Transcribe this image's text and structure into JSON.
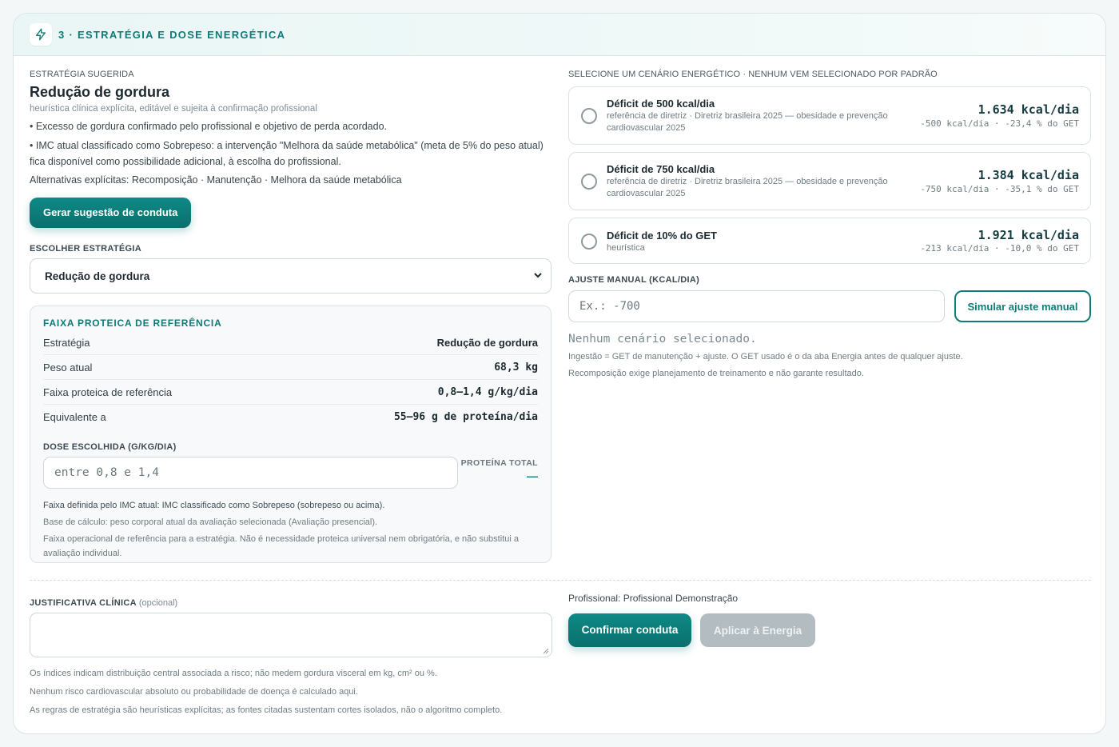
{
  "header": {
    "title": "3 · ESTRATÉGIA E DOSE ENERGÉTICA",
    "icon": "bolt-icon"
  },
  "strategy": {
    "section_label": "ESTRATÉGIA SUGERIDA",
    "title": "Redução de gordura",
    "subtitle": "heurística clínica explícita, editável e sujeita à confirmação profissional",
    "bullets": [
      "• Excesso de gordura confirmado pelo profissional e objetivo de perda acordado.",
      "• IMC atual classificado como Sobrepeso: a intervenção \"Melhora da saúde metabólica\" (meta de 5% do peso atual) fica disponível como possibilidade adicional, à escolha do profissional."
    ],
    "alternatives": "Alternativas explícitas: Recomposição · Manutenção · Melhora da saúde metabólica",
    "suggest_button": "Gerar sugestão de conduta",
    "choose_label": "ESCOLHER ESTRATÉGIA",
    "choose_value": "Redução de gordura"
  },
  "reference": {
    "title": "FAIXA PROTEICA DE REFERÊNCIA",
    "rows": [
      {
        "label": "Estratégia",
        "value": "Redução de gordura"
      },
      {
        "label": "Peso atual",
        "value": "68,3 kg"
      },
      {
        "label": "Faixa proteica de referência",
        "value": "0,8–1,4 g/kg/dia"
      },
      {
        "label": "Equivalente a",
        "value": "55–96 g de proteína/dia"
      }
    ],
    "dose_label": "DOSE ESCOLHIDA (G/KG/DIA)",
    "dose_placeholder": "entre 0,8 e 1,4",
    "total_label": "PROTEÍNA TOTAL",
    "total_value": "—",
    "notes": [
      "Faixa definida pelo IMC atual: IMC classificado como Sobrepeso (sobrepeso ou acima).",
      "Base de cálculo: peso corporal atual da avaliação selecionada (Avaliação presencial).",
      "Faixa operacional de referência para a estratégia. Não é necessidade proteica universal nem obrigatória, e não substitui a avaliação individual."
    ]
  },
  "scenarios": {
    "section_label": "SELECIONE UM CENÁRIO ENERGÉTICO · NENHUM VEM SELECIONADO POR PADRÃO",
    "items": [
      {
        "title": "Déficit de 500 kcal/dia",
        "source": "referência de diretriz · Diretriz brasileira 2025 — obesidade e prevenção cardiovascular 2025",
        "kcal": "1.634 kcal/dia",
        "delta": "-500 kcal/dia · -23,4 % do GET"
      },
      {
        "title": "Déficit de 750 kcal/dia",
        "source": "referência de diretriz · Diretriz brasileira 2025 — obesidade e prevenção cardiovascular 2025",
        "kcal": "1.384 kcal/dia",
        "delta": "-750 kcal/dia · -35,1 % do GET"
      },
      {
        "title": "Déficit de 10% do GET",
        "source": "heurística",
        "kcal": "1.921 kcal/dia",
        "delta": "-213 kcal/dia · -10,0 % do GET"
      }
    ],
    "manual_label": "AJUSTE MANUAL (KCAL/DIA)",
    "manual_placeholder": "Ex.: -700",
    "simulate_button": "Simular ajuste manual",
    "none_selected": "Nenhum cenário selecionado.",
    "info": [
      "Ingestão = GET de manutenção + ajuste. O GET usado é o da aba Energia antes de qualquer ajuste.",
      "Recomposição exige planejamento de treinamento e não garante resultado."
    ]
  },
  "footer": {
    "justification_label": "JUSTIFICATIVA CLÍNICA",
    "justification_optional": "(opcional)",
    "disclaimers": [
      "Os índices indicam distribuição central associada a risco; não medem gordura visceral em kg, cm² ou %.",
      "Nenhum risco cardiovascular absoluto ou probabilidade de doença é calculado aqui.",
      "As regras de estratégia são heurísticas explícitas; as fontes citadas sustentam cortes isolados, não o algoritmo completo."
    ],
    "professional": "Profissional: Profissional Demonstração",
    "confirm_button": "Confirmar conduta",
    "apply_button": "Aplicar à Energia"
  },
  "colors": {
    "accent": "#0e7d7a",
    "disabled": "#b3bcc1"
  }
}
